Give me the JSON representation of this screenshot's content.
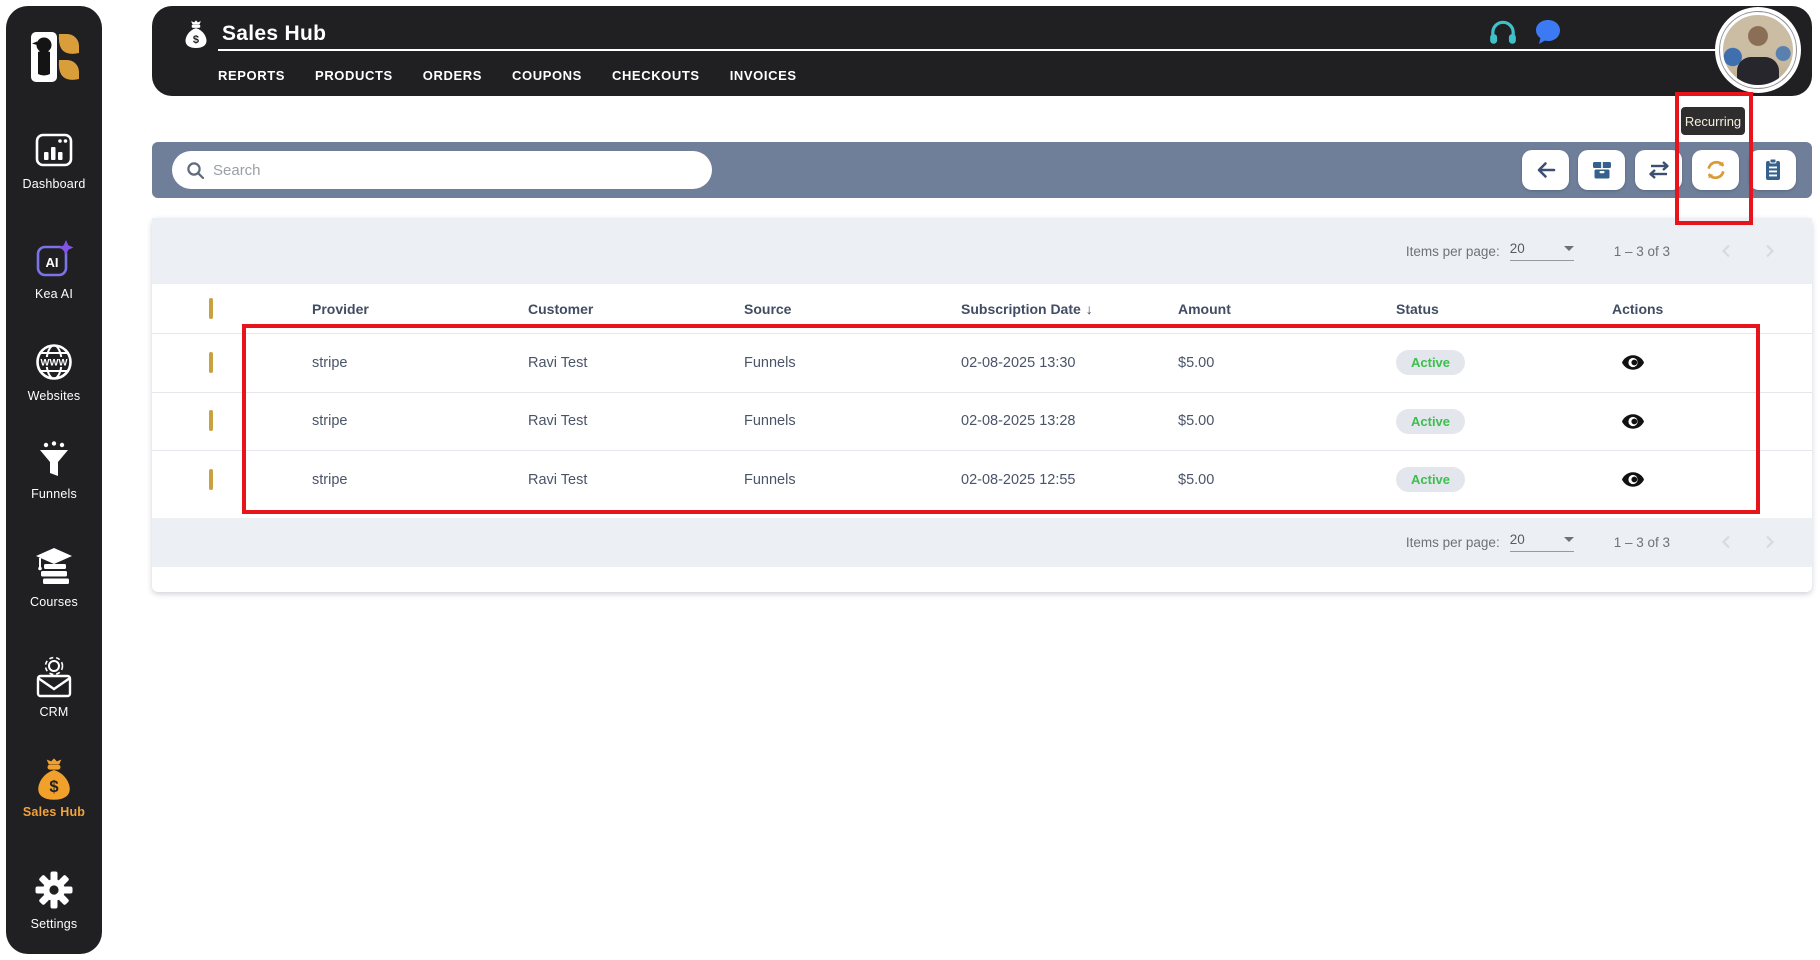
{
  "app": {
    "title": "Sales Hub"
  },
  "header": {
    "nav": [
      "REPORTS",
      "PRODUCTS",
      "ORDERS",
      "COUPONS",
      "CHECKOUTS",
      "INVOICES"
    ],
    "icons": {
      "support": "headphones",
      "chat": "chat-bubble",
      "title_icon": "money-bag"
    }
  },
  "toolbar": {
    "search_placeholder": "Search",
    "icons": {
      "back": "arrow-left",
      "products": "package",
      "transactions": "swap-horizontal",
      "recurring": "refresh",
      "list": "clipboard"
    }
  },
  "tooltip": {
    "label": "Recurring"
  },
  "pagination": {
    "items_per_page_label": "Items per page:",
    "items_per_page": "20",
    "range_label": "1 – 3 of 3"
  },
  "table": {
    "columns": {
      "provider": "Provider",
      "customer": "Customer",
      "source": "Source",
      "subscription_date": "Subscription Date",
      "amount": "Amount",
      "status": "Status",
      "actions": "Actions"
    },
    "sort_arrow": "↓",
    "rows": [
      {
        "provider": "stripe",
        "customer": "Ravi Test",
        "source": "Funnels",
        "subscription_date": "02-08-2025 13:30",
        "amount": "$5.00",
        "status": "Active"
      },
      {
        "provider": "stripe",
        "customer": "Ravi Test",
        "source": "Funnels",
        "subscription_date": "02-08-2025 13:28",
        "amount": "$5.00",
        "status": "Active"
      },
      {
        "provider": "stripe",
        "customer": "Ravi Test",
        "source": "Funnels",
        "subscription_date": "02-08-2025 12:55",
        "amount": "$5.00",
        "status": "Active"
      }
    ]
  },
  "sidebar": {
    "items": [
      {
        "label": "Dashboard",
        "icon": "dashboard-window"
      },
      {
        "label": "Kea AI",
        "icon": "ai-sparkle"
      },
      {
        "label": "Websites",
        "icon": "globe-www"
      },
      {
        "label": "Funnels",
        "icon": "funnel"
      },
      {
        "label": "Courses",
        "icon": "graduation-books"
      },
      {
        "label": "CRM",
        "icon": "envelope-gear"
      },
      {
        "label": "Sales Hub",
        "icon": "money-bag",
        "active": true
      },
      {
        "label": "Settings",
        "icon": "gear"
      }
    ]
  },
  "icon_glyphs": {
    "ai": "AI",
    "www": "WWW",
    "dollar": "$"
  },
  "colors": {
    "dark": "#201F21",
    "toolbar_slate": "#6F7E99",
    "accent_orange": "#F2A33C",
    "annotation_red": "#E8141B",
    "active_green": "#3CBF4C",
    "badge_bg": "#E4E6EE",
    "checkbox_gold": "#C8A23E",
    "teal": "#3FC1C9",
    "chat_blue": "#3B7AF2",
    "icon_steel_blue": "#35618C",
    "icon_navy": "#3D4E73",
    "kea_purple": "#7B74E8",
    "strip_bg": "#ECF0F5"
  }
}
